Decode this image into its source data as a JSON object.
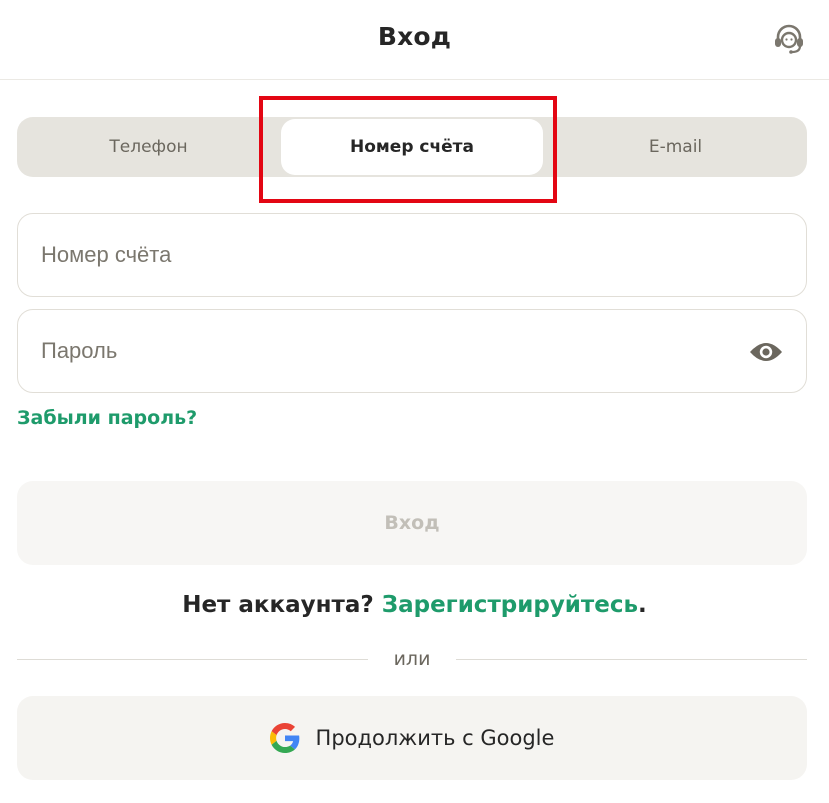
{
  "header": {
    "title": "Вход",
    "support_icon": "headset-icon"
  },
  "tabs": [
    {
      "label": "Телефон",
      "active": false
    },
    {
      "label": "Номер счёта",
      "active": true
    },
    {
      "label": "E-mail",
      "active": false
    }
  ],
  "form": {
    "account_placeholder": "Номер счёта",
    "account_value": "",
    "password_placeholder": "Пароль",
    "password_value": "",
    "eye_icon": "eye-icon",
    "forgot_label": "Забыли пароль?",
    "login_label": "Вход"
  },
  "signup": {
    "prompt": "Нет аккаунта?",
    "link": "Зарегистрируйтесь",
    "suffix": "."
  },
  "divider": {
    "label": "или"
  },
  "google": {
    "label": "Продолжить с Google",
    "icon": "google-icon"
  },
  "colors": {
    "accent": "#1e9b6b",
    "highlight": "#e30613",
    "tab_bg": "#e6e4de",
    "disabled_text": "#c2bfb8"
  }
}
